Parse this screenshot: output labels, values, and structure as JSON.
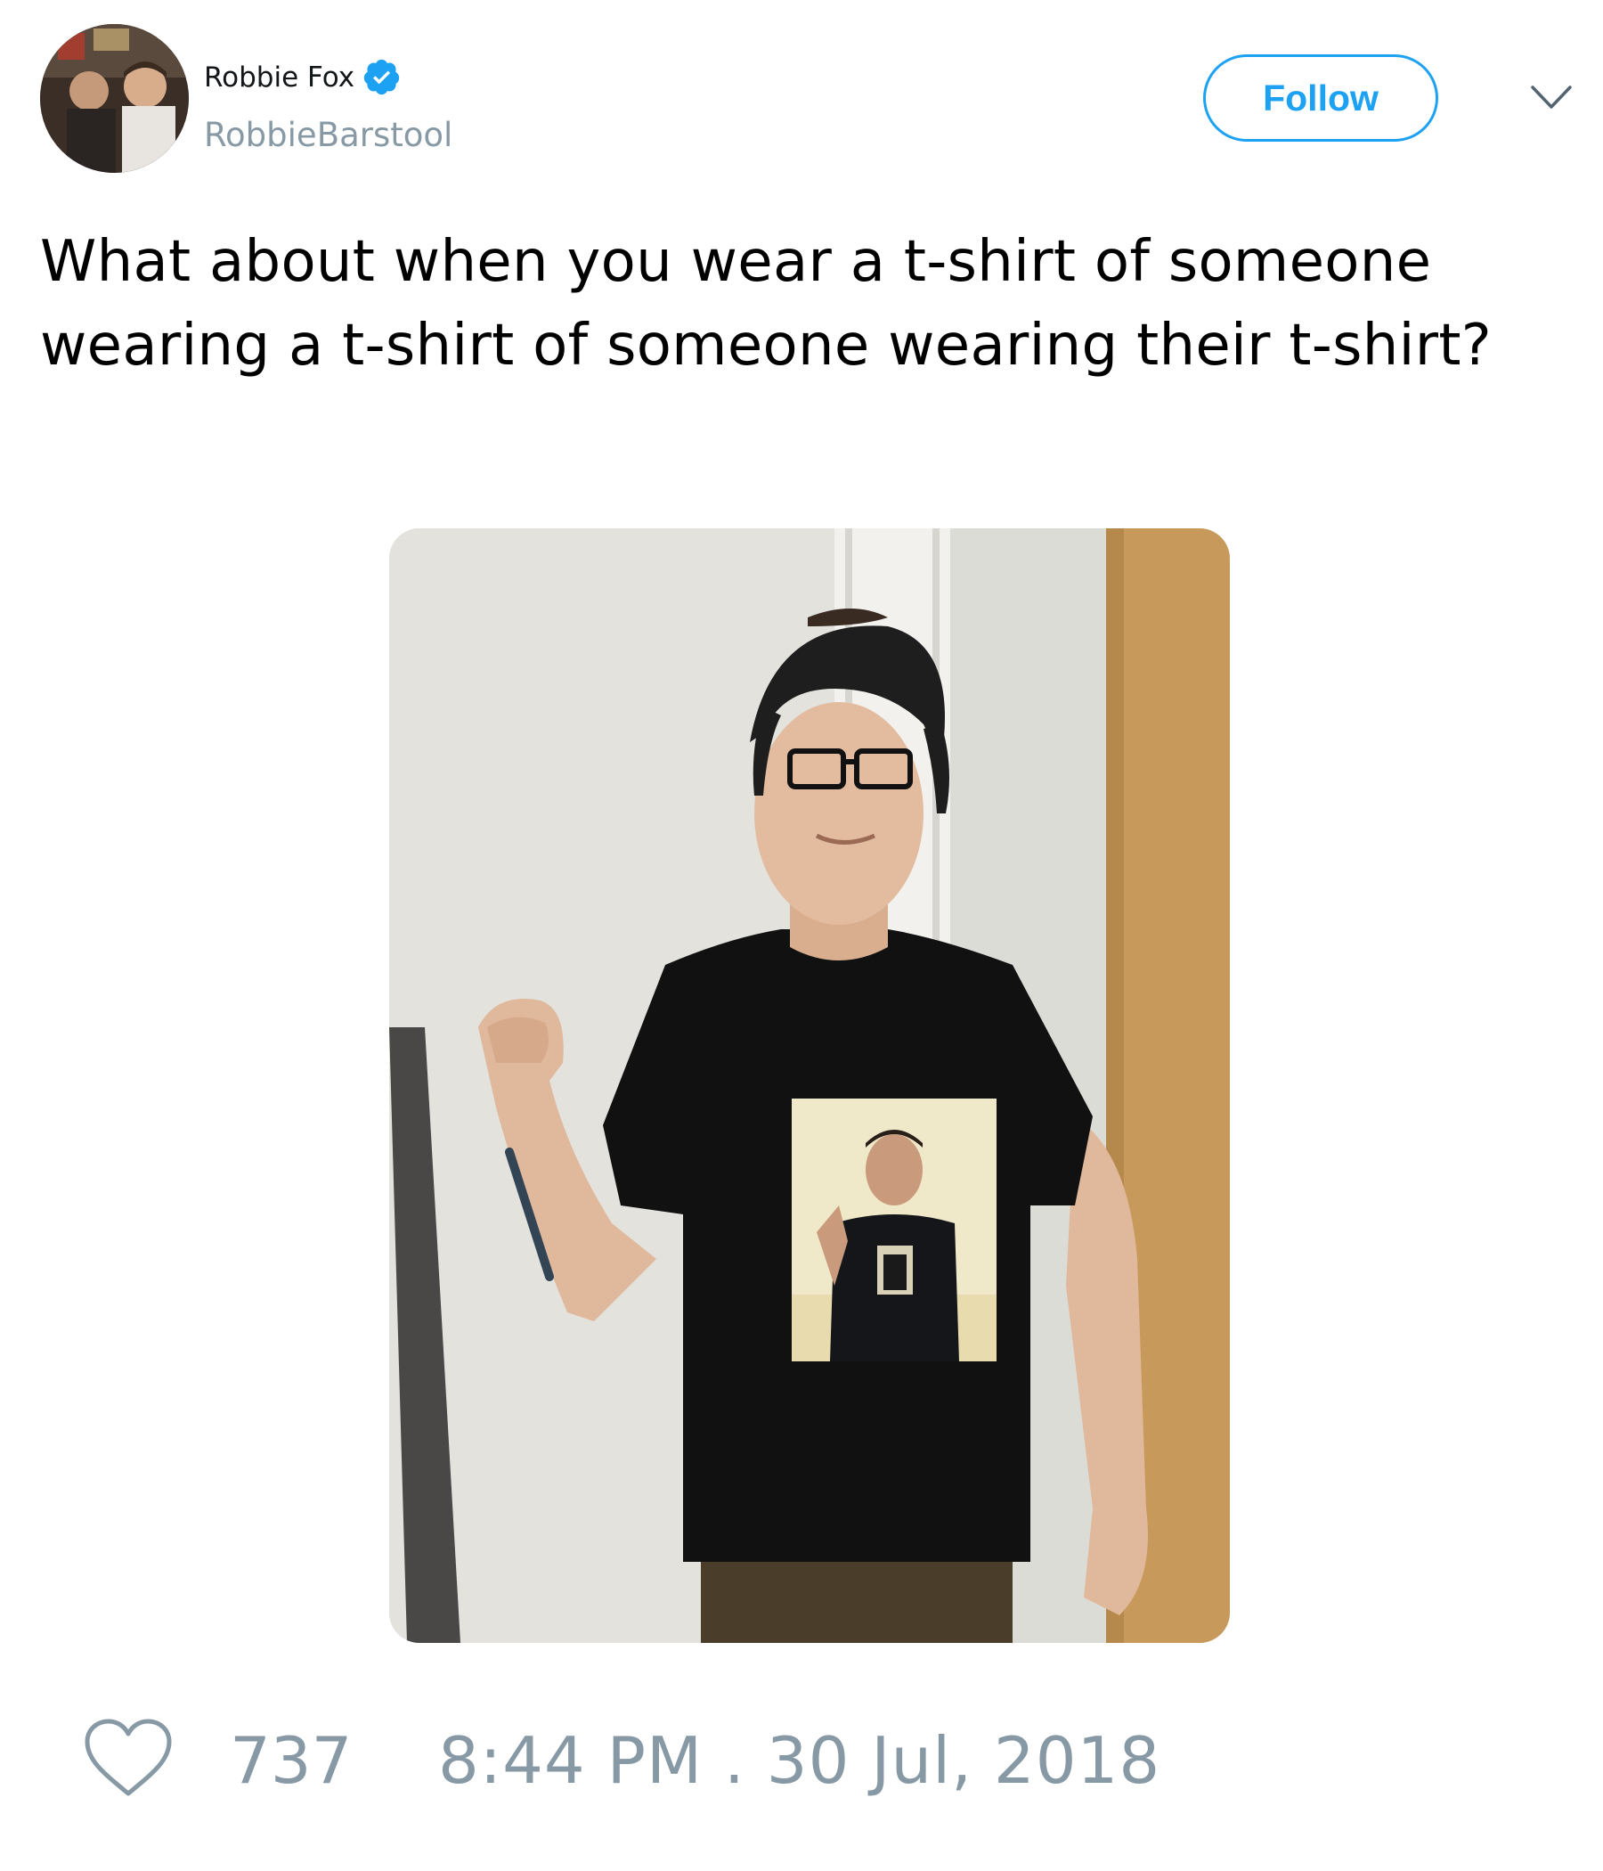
{
  "author": {
    "name": "Robbie Fox",
    "handle": "RobbieBarstool",
    "verified": true
  },
  "follow_label": "Follow",
  "tweet": {
    "text": "What about when you wear a t-shirt of someone wearing a t-shirt of someone wearing their t-shirt?",
    "like_count": "737",
    "timestamp": "8:44 PM . 30 Jul, 2018"
  },
  "colors": {
    "accent": "#1da1f2",
    "muted": "#8899a6",
    "text": "#000000"
  },
  "icons": {
    "verified": "verified-badge-icon",
    "menu": "chevron-down-icon",
    "like": "heart-icon"
  }
}
